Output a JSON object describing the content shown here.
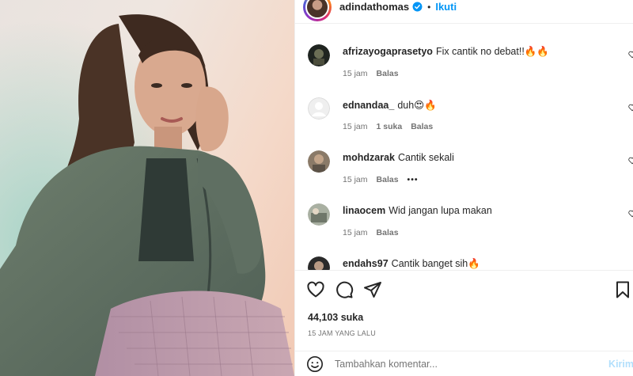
{
  "header": {
    "username": "adindathomas",
    "separator": "•",
    "follow_label": "Ikuti"
  },
  "comments": [
    {
      "user": "afrizayogaprasetyo",
      "text": "Fix cantik no debat!!🔥🔥",
      "time": "15 jam",
      "likes": "",
      "reply": "Balas",
      "more": ""
    },
    {
      "user": "ednandaa_",
      "text": "duh😍🔥",
      "time": "15 jam",
      "likes": "1 suka",
      "reply": "Balas",
      "more": ""
    },
    {
      "user": "mohdzarak",
      "text": "Cantik sekali",
      "time": "15 jam",
      "likes": "",
      "reply": "Balas",
      "more": "•••"
    },
    {
      "user": "linaocem",
      "text": "Wid jangan lupa makan",
      "time": "15 jam",
      "likes": "",
      "reply": "Balas",
      "more": ""
    },
    {
      "user": "endahs97",
      "text": "Cantik banget sih🔥",
      "time": "",
      "likes": "",
      "reply": "",
      "more": ""
    }
  ],
  "post": {
    "likes": "44,103 suka",
    "timestamp": "15 JAM YANG LALU"
  },
  "add_comment": {
    "placeholder": "Tambahkan komentar...",
    "post_label": "Kirim"
  },
  "icons": {
    "verified": "verified-badge-icon",
    "like": "heart-icon",
    "comment": "comment-bubble-icon",
    "share": "paper-plane-icon",
    "save": "bookmark-icon",
    "emoji": "smiley-icon"
  },
  "colors": {
    "accent": "#0095f6",
    "muted": "#737373",
    "post_disabled": "#b2dffc"
  }
}
